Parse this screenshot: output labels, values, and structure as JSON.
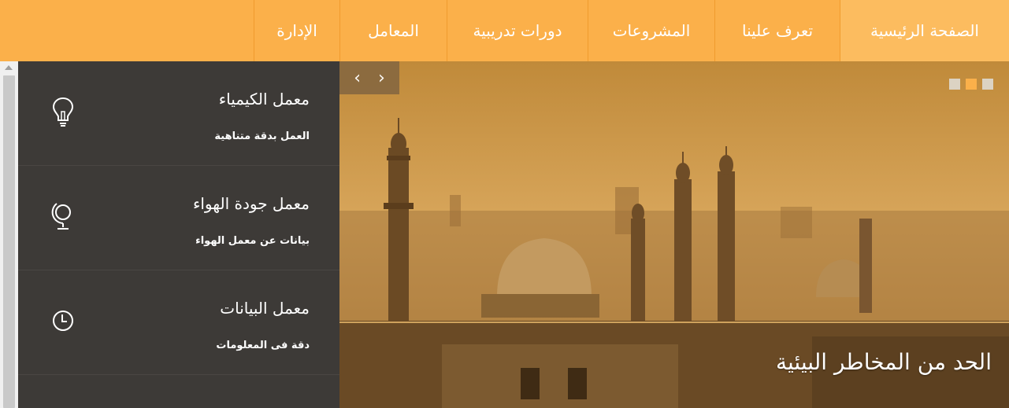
{
  "nav": {
    "items": [
      {
        "label": "الصفحة الرئيسية"
      },
      {
        "label": "تعرف علينا"
      },
      {
        "label": "المشروعات"
      },
      {
        "label": "دورات تدريبية"
      },
      {
        "label": "المعامل"
      },
      {
        "label": "الإدارة"
      }
    ]
  },
  "sidebar": {
    "labs": [
      {
        "title": "معمل الكيمياء",
        "subtitle": "العمل بدقة متناهية",
        "icon": "lightbulb-icon"
      },
      {
        "title": "معمل جودة الهواء",
        "subtitle": "بيانات عن معمل الهواء",
        "icon": "globe-icon"
      },
      {
        "title": "معمل البيانات",
        "subtitle": "دقة فى المعلومات",
        "icon": "clock-icon"
      }
    ]
  },
  "slider": {
    "prev_label": "‹",
    "next_label": "›",
    "caption": "الحد من المخاطر البيئية"
  },
  "colors": {
    "accent": "#fbb04a",
    "sidebar_bg": "#3d3a37"
  }
}
